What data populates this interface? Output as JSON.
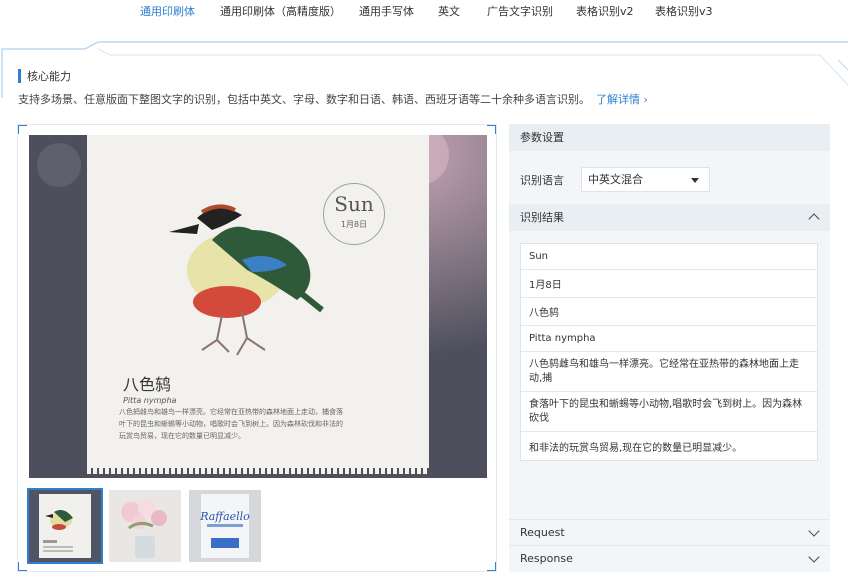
{
  "tabs": [
    {
      "label": "通用印刷体",
      "active": true
    },
    {
      "label": "通用印刷体（高精度版）",
      "active": false
    },
    {
      "label": "通用手写体",
      "active": false
    },
    {
      "label": "英文",
      "active": false
    },
    {
      "label": "广告文字识别",
      "active": false
    },
    {
      "label": "表格识别v2",
      "active": false
    },
    {
      "label": "表格识别v3",
      "active": false
    }
  ],
  "section": {
    "title": "核心能力",
    "description": "支持多场景、任意版面下整图文字的识别，包括中英文、字母、数字和日语、韩语、西班牙语等二十余种多语言识别。",
    "link": "了解详情"
  },
  "preview": {
    "card_day": "Sun",
    "card_date": "1月8日",
    "bird_name": "八色鸫",
    "bird_latin": "Pitta nympha",
    "bird_desc": "八色鸫雌鸟和雄鸟一样漂亮。它经常在亚热带的森林地面上走动，捕食落叶下的昆虫和蜥蜴等小动物，唱歌时会飞到树上。因为森林砍伐和非法的玩赏鸟贸易，现在它的数量已明显减少。"
  },
  "thumbnails": [
    {
      "name": "bird-card",
      "selected": true
    },
    {
      "name": "flowers",
      "selected": false
    },
    {
      "name": "raffaello-box",
      "selected": false,
      "logo": "Raffaello"
    }
  ],
  "params": {
    "header": "参数设置",
    "language_label": "识别语言",
    "language_value": "中英文混合"
  },
  "results": {
    "header": "识别结果",
    "rows": [
      "Sun",
      "1月8日",
      "八色鸫",
      "Pitta nympha",
      "八色鸫雌鸟和雄鸟一样漂亮。它经常在亚热带的森林地面上走动,捕",
      "食落叶下的昆虫和蜥蜴等小动物,唱歌时会飞到树上。因为森林砍伐",
      "和非法的玩赏鸟贸易,现在它的数量已明显减少。"
    ]
  },
  "request_label": "Request",
  "response_label": "Response",
  "colors": {
    "accent": "#2f80d1",
    "panel": "#f3f6f9"
  }
}
